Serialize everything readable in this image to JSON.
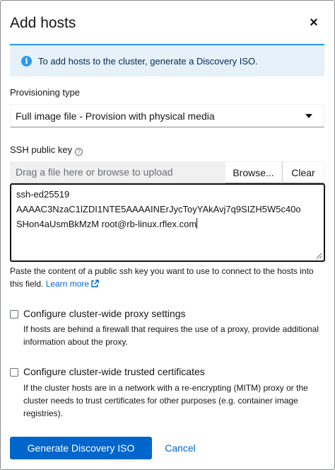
{
  "dialog": {
    "title": "Add hosts",
    "close_glyph": "×"
  },
  "alert": {
    "icon": "info-icon",
    "text": "To add hosts to the cluster, generate a Discovery ISO."
  },
  "provisioning": {
    "label": "Provisioning type",
    "selected": "Full image file - Provision with physical media"
  },
  "ssh": {
    "label": "SSH public key",
    "help_glyph": "?",
    "drop_placeholder": "Drag a file here or browse to upload",
    "browse_label": "Browse...",
    "clear_label": "Clear",
    "value_lines": [
      "ssh-ed25519",
      "AAAAC3NzaC1lZDI1NTE5AAAAINErJycToyYAkAvj7q9SIZH5W5c40o",
      "SHon4aUsmBkMzM root@rb-linux.rflex.com"
    ],
    "helper_text": "Paste the content of a public ssh key you want to use to connect to the hosts into this field.",
    "learn_more": "Learn more"
  },
  "proxy": {
    "label": "Configure cluster-wide proxy settings",
    "checked": false,
    "description": "If hosts are behind a firewall that requires the use of a proxy, provide additional information about the proxy."
  },
  "certs": {
    "label": "Configure cluster-wide trusted certificates",
    "checked": false,
    "description": "If the cluster hosts are in a network with a re-encrypting (MITM) proxy or the cluster needs to trust certificates for other purposes (e.g. container image registries)."
  },
  "footer": {
    "primary_label": "Generate Discovery ISO",
    "cancel_label": "Cancel"
  },
  "colors": {
    "primary": "#0066cc",
    "info": "#2b9af3",
    "alert_bg": "#e7f1fa"
  }
}
